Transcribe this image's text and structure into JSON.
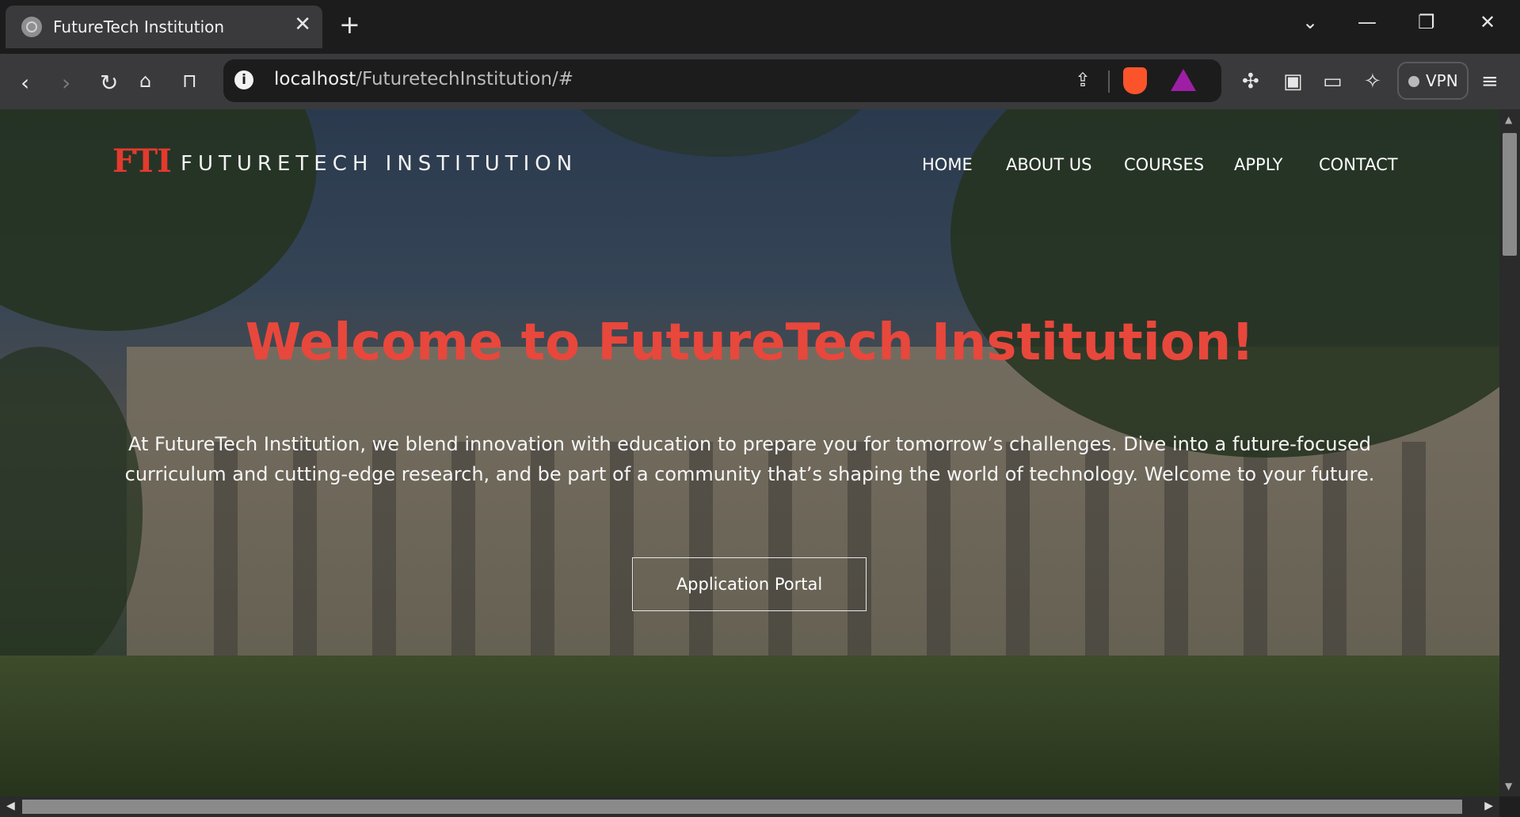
{
  "browser": {
    "tab_title": "FutureTech Institution",
    "tab_close": "✕",
    "new_tab": "+",
    "url_host": "localhost",
    "url_path": "/FuturetechInstitution/#",
    "vpn_label": "VPN",
    "window_controls": [
      "⌄",
      "—",
      "❐",
      "✕"
    ],
    "info_icon": "i"
  },
  "site": {
    "logo_mark": "FTI",
    "logo_text": "FUTURETECH INSTITUTION",
    "nav": [
      "HOME",
      "ABOUT US",
      "COURSES",
      "APPLY",
      "CONTACT"
    ],
    "hero_title": "Welcome to FutureTech Institution!",
    "hero_text": "At FutureTech Institution, we blend innovation with education to prepare you for tomorrow’s challenges. Dive into a future-focused curriculum and cutting-edge research, and be part of a community that’s shaping the world of technology. Welcome to your future.",
    "portal_button": "Application Portal"
  },
  "colors": {
    "accent": "#e8473c",
    "logo": "#e23b2e"
  }
}
